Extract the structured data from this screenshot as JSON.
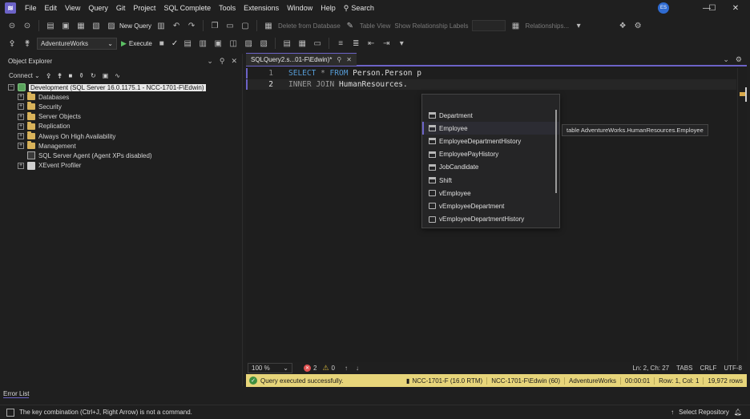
{
  "menu": {
    "items": [
      "File",
      "Edit",
      "View",
      "Query",
      "Git",
      "Project",
      "SQL Complete",
      "Tools",
      "Extensions",
      "Window",
      "Help"
    ],
    "search_label": "Search",
    "avatar_initials": "ES"
  },
  "toolbar1": {
    "new_query_label": "New Query",
    "delete_from_db_label": "Delete from Database",
    "table_view_label": "Table View",
    "show_relationship_labels": "Show Relationship Labels",
    "relationships_label": "Relationships..."
  },
  "toolbar2": {
    "database": "AdventureWorks",
    "execute_label": "Execute"
  },
  "object_explorer": {
    "title": "Object Explorer",
    "connect_label": "Connect",
    "server_node": "Development (SQL Server 16.0.1175.1 - NCC-1701-F\\Edwin)",
    "children": [
      {
        "label": "Databases",
        "type": "folder"
      },
      {
        "label": "Security",
        "type": "folder"
      },
      {
        "label": "Server Objects",
        "type": "folder"
      },
      {
        "label": "Replication",
        "type": "folder"
      },
      {
        "label": "Always On High Availability",
        "type": "folder"
      },
      {
        "label": "Management",
        "type": "folder"
      },
      {
        "label": "SQL Server Agent (Agent XPs disabled)",
        "type": "agent"
      },
      {
        "label": "XEvent Profiler",
        "type": "xevent"
      }
    ]
  },
  "editor": {
    "tab_title": "SQLQuery2.s...01-F\\Edwin)*",
    "lines": [
      {
        "number": "1",
        "kw1": "SELECT",
        "star": "*",
        "kw2": "FROM",
        "rest": "Person.Person p"
      },
      {
        "number": "2",
        "kw1": "INNER JOIN",
        "rest": "HumanResources."
      }
    ]
  },
  "completion": {
    "items": [
      {
        "label": "Department",
        "kind": "table"
      },
      {
        "label": "Employee",
        "kind": "table"
      },
      {
        "label": "EmployeeDepartmentHistory",
        "kind": "table"
      },
      {
        "label": "EmployeePayHistory",
        "kind": "table"
      },
      {
        "label": "JobCandidate",
        "kind": "table"
      },
      {
        "label": "Shift",
        "kind": "table"
      },
      {
        "label": "vEmployee",
        "kind": "view"
      },
      {
        "label": "vEmployeeDepartment",
        "kind": "view"
      },
      {
        "label": "vEmployeeDepartmentHistory",
        "kind": "view"
      }
    ],
    "selected": "Employee",
    "tooltip": "table AdventureWorks.HumanResources.Employee"
  },
  "editor_bottom": {
    "zoom": "100 %",
    "errors": "2",
    "warnings": "0",
    "position": "Ln: 2, Ch: 27",
    "indent": "TABS",
    "line_ending": "CRLF",
    "encoding": "UTF-8"
  },
  "query_status": {
    "message": "Query executed successfully.",
    "server": "NCC-1701-F (16.0 RTM)",
    "user": "NCC-1701-F\\Edwin (60)",
    "database": "AdventureWorks",
    "elapsed": "00:00:01",
    "row_col": "Row: 1, Col: 1",
    "rows": "19,972 rows"
  },
  "error_list": {
    "tab_label": "Error List"
  },
  "statusbar": {
    "message": "The key combination (Ctrl+J, Right Arrow) is not a command.",
    "repo_label": "Select Repository"
  },
  "colors": {
    "accent": "#6c63c7",
    "status_bar": "#e7d57a",
    "keyword": "#569cd6"
  }
}
